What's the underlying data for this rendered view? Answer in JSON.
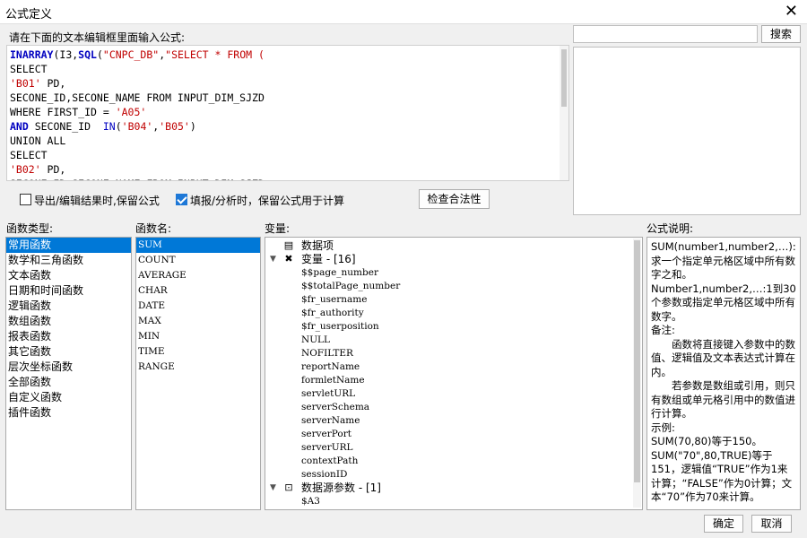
{
  "window": {
    "title": "公式定义"
  },
  "editor": {
    "label": "请在下面的文本编辑框里面输入公式:",
    "lines": [
      [
        {
          "t": "INARRAY",
          "c": "kw"
        },
        {
          "t": "(I3,"
        },
        {
          "t": "SQL",
          "c": "kw"
        },
        {
          "t": "("
        },
        {
          "t": "\"CNPC_DB\"",
          "c": "str"
        },
        {
          "t": ","
        },
        {
          "t": "\"SELECT * FROM (",
          "c": "str"
        }
      ],
      [
        {
          "t": "SELECT"
        }
      ],
      [
        {
          "t": "'B01'",
          "c": "str"
        },
        {
          "t": " PD,"
        }
      ],
      [
        {
          "t": "SECONE_ID,SECONE_NAME FROM INPUT_DIM_SJZD"
        }
      ],
      [
        {
          "t": "WHERE FIRST_ID = "
        },
        {
          "t": "'A05'",
          "c": "str"
        }
      ],
      [
        {
          "t": "AND",
          "c": "kw"
        },
        {
          "t": " SECONE_ID  "
        },
        {
          "t": "IN",
          "c": "fn"
        },
        {
          "t": "("
        },
        {
          "t": "'B04'",
          "c": "str"
        },
        {
          "t": ","
        },
        {
          "t": "'B05'",
          "c": "str"
        },
        {
          "t": ")"
        }
      ],
      [
        {
          "t": "UNION ALL"
        }
      ],
      [
        {
          "t": "SELECT"
        }
      ],
      [
        {
          "t": "'B02'",
          "c": "str"
        },
        {
          "t": " PD,"
        }
      ],
      [
        {
          "t": "SECONE_ID,SECONE_NAME FROM INPUT_DIM_SJZD"
        }
      ]
    ]
  },
  "search": {
    "placeholder": "",
    "button": "搜索"
  },
  "options": {
    "export_keep": {
      "label": "导出/编辑结果时,保留公式",
      "checked": false
    },
    "fill_keep": {
      "label": "填报/分析时，保留公式用于计算",
      "checked": true
    },
    "check_button": "检查合法性"
  },
  "function_types": {
    "label": "函数类型:",
    "selected": 0,
    "items": [
      "常用函数",
      "数学和三角函数",
      "文本函数",
      "日期和时间函数",
      "逻辑函数",
      "数组函数",
      "报表函数",
      "其它函数",
      "层次坐标函数",
      "全部函数",
      "自定义函数",
      "插件函数"
    ]
  },
  "function_names": {
    "label": "函数名:",
    "selected": 0,
    "items": [
      "SUM",
      "COUNT",
      "AVERAGE",
      "CHAR",
      "DATE",
      "MAX",
      "MIN",
      "TIME",
      "RANGE"
    ]
  },
  "variables": {
    "label": "变量:",
    "rows": [
      {
        "type": "cat",
        "icon": "▤",
        "arrow": "",
        "text": "数据项"
      },
      {
        "type": "cat",
        "icon": "✖",
        "arrow": "▼",
        "text": "变量 - [16]"
      },
      {
        "type": "var",
        "text": "$$page_number"
      },
      {
        "type": "var",
        "text": "$$totalPage_number"
      },
      {
        "type": "var",
        "text": "$fr_username"
      },
      {
        "type": "var",
        "text": "$fr_authority"
      },
      {
        "type": "var",
        "text": "$fr_userposition"
      },
      {
        "type": "var",
        "text": "NULL"
      },
      {
        "type": "var",
        "text": "NOFILTER"
      },
      {
        "type": "var",
        "text": "reportName"
      },
      {
        "type": "var",
        "text": "formletName"
      },
      {
        "type": "var",
        "text": "servletURL"
      },
      {
        "type": "var",
        "text": "serverSchema"
      },
      {
        "type": "var",
        "text": "serverName"
      },
      {
        "type": "var",
        "text": "serverPort"
      },
      {
        "type": "var",
        "text": "serverURL"
      },
      {
        "type": "var",
        "text": "contextPath"
      },
      {
        "type": "var",
        "text": "sessionID"
      },
      {
        "type": "cat",
        "icon": "⊡",
        "arrow": "▼",
        "text": "数据源参数 - [1]"
      },
      {
        "type": "var",
        "text": "$A3"
      }
    ]
  },
  "description": {
    "label": "公式说明:",
    "paragraphs": [
      {
        "text": "SUM(number1,number2,…): 求一个指定单元格区域中所有数字之和。",
        "indent": false
      },
      {
        "text": "Number1,number2,…:1到30个参数或指定单元格区域中所有数字。",
        "indent": false
      },
      {
        "text": "备注:",
        "indent": false
      },
      {
        "text": "函数将直接键入参数中的数值、逻辑值及文本表达式计算在内。",
        "indent": true
      },
      {
        "text": "若参数是数组或引用，则只有数组或单元格引用中的数值进行计算。",
        "indent": true
      },
      {
        "text": "示例:",
        "indent": false
      },
      {
        "text": "SUM(70,80)等于150。",
        "indent": false
      },
      {
        "text": "SUM(\"70\",80,TRUE)等于151，逻辑值“TRUE”作为1来计算；“FALSE”作为0计算；文本“70”作为70来计算。",
        "indent": false
      }
    ]
  },
  "footer": {
    "ok": "确定",
    "cancel": "取消"
  },
  "colors": {
    "selection": "#0078d7",
    "keyword": "#0000c0",
    "string": "#c00000"
  }
}
